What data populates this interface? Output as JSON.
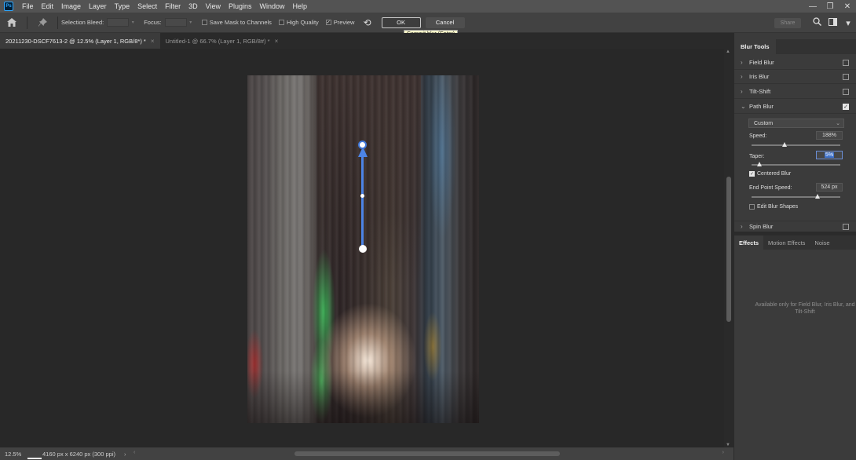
{
  "menubar": {
    "logo": "Ps",
    "items": [
      "File",
      "Edit",
      "Image",
      "Layer",
      "Type",
      "Select",
      "Filter",
      "3D",
      "View",
      "Plugins",
      "Window",
      "Help"
    ],
    "window_controls": [
      "—",
      "❐",
      "✕"
    ]
  },
  "options": {
    "selection_bleed_label": "Selection Bleed:",
    "focus_label": "Focus:",
    "save_mask_label": "Save Mask to Channels",
    "high_quality_label": "High Quality",
    "preview_label": "Preview",
    "preview_checked": true,
    "ok_label": "OK",
    "cancel_label": "Cancel",
    "share_label": "Share",
    "tooltip": "Commit blur (Enter)"
  },
  "tabs": [
    {
      "title": "20211230-DSCF7613-2 @ 12.5% (Layer 1, RGB/8*) *",
      "active": true
    },
    {
      "title": "Untitled-1 @ 66.7% (Layer 1, RGB/8#) *",
      "active": false
    }
  ],
  "status": {
    "zoom": "12.5%",
    "doc_info": "4160 px x 6240 px (300 ppi)"
  },
  "panel": {
    "title": "Blur Tools",
    "tools": [
      {
        "label": "Field Blur",
        "checked": false,
        "expanded": false
      },
      {
        "label": "Iris Blur",
        "checked": false,
        "expanded": false
      },
      {
        "label": "Tilt-Shift",
        "checked": false,
        "expanded": false
      },
      {
        "label": "Path Blur",
        "checked": true,
        "expanded": true
      },
      {
        "label": "Spin Blur",
        "checked": false,
        "expanded": false
      }
    ],
    "path_blur": {
      "preset": "Custom",
      "speed_label": "Speed:",
      "speed_value": "188%",
      "speed_fraction": 0.37,
      "taper_label": "Taper:",
      "taper_value": "5%",
      "taper_fraction": 0.09,
      "centered_blur_label": "Centered Blur",
      "centered_blur_checked": true,
      "end_point_speed_label": "End Point Speed:",
      "end_point_speed_value": "524 px",
      "end_point_speed_fraction": 0.74,
      "edit_blur_shapes_label": "Edit Blur Shapes",
      "edit_blur_shapes_checked": false
    },
    "effects_tabs": [
      "Effects",
      "Motion Effects",
      "Noise"
    ],
    "effects_note": "Available only for Field Blur, Iris Blur, and Tilt-Shift"
  }
}
